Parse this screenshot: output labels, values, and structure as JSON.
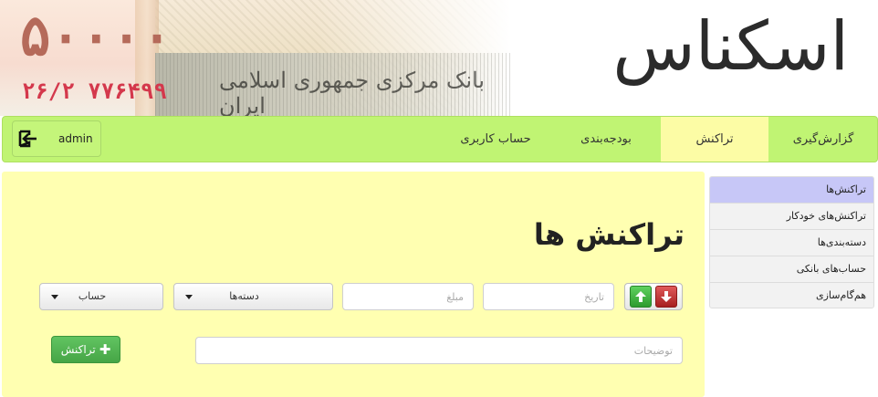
{
  "banner": {
    "amount": "۵۰۰۰۰",
    "serial": "۲۶/۲ ۷۷۶۴۹۹",
    "note_text": "بانک مرکزی جمهوری اسلامی ایران",
    "logo": "اسکناس"
  },
  "navbar": {
    "items": [
      {
        "label": "گزارش‌گیری",
        "active": false
      },
      {
        "label": "تراکنش",
        "active": true
      },
      {
        "label": "بودجه‌بندی",
        "active": false
      },
      {
        "label": "حساب کاربری",
        "active": false
      }
    ],
    "user": {
      "name": "admin",
      "icon": "exit-icon"
    }
  },
  "main": {
    "title": "تراکنش ها",
    "direction_buttons": {
      "up_icon": "arrow-up-icon",
      "down_icon": "arrow-down-icon",
      "up_color": "#2e9b2e",
      "down_color": "#a61f1f"
    },
    "date_placeholder": "تاریخ",
    "amount_placeholder": "مبلغ",
    "category_select": "دسته‌ها",
    "account_select": "حساب",
    "description_placeholder": "توضیحات",
    "add_button": "تراکنش"
  },
  "sidebar": {
    "items": [
      {
        "label": "تراکنش‌ها",
        "active": true
      },
      {
        "label": "تراکنش‌های خودکار",
        "active": false
      },
      {
        "label": "دسته‌بندی‌ها",
        "active": false
      },
      {
        "label": "حساب‌های بانکی",
        "active": false
      },
      {
        "label": "هم‌گام‌سازی",
        "active": false
      }
    ]
  },
  "colors": {
    "navbar": "#c0f473",
    "content": "#ffffb1",
    "active_tab": "#fcfca5",
    "sidebar_active": "#c7c7f7",
    "add_button": "#46a546"
  }
}
